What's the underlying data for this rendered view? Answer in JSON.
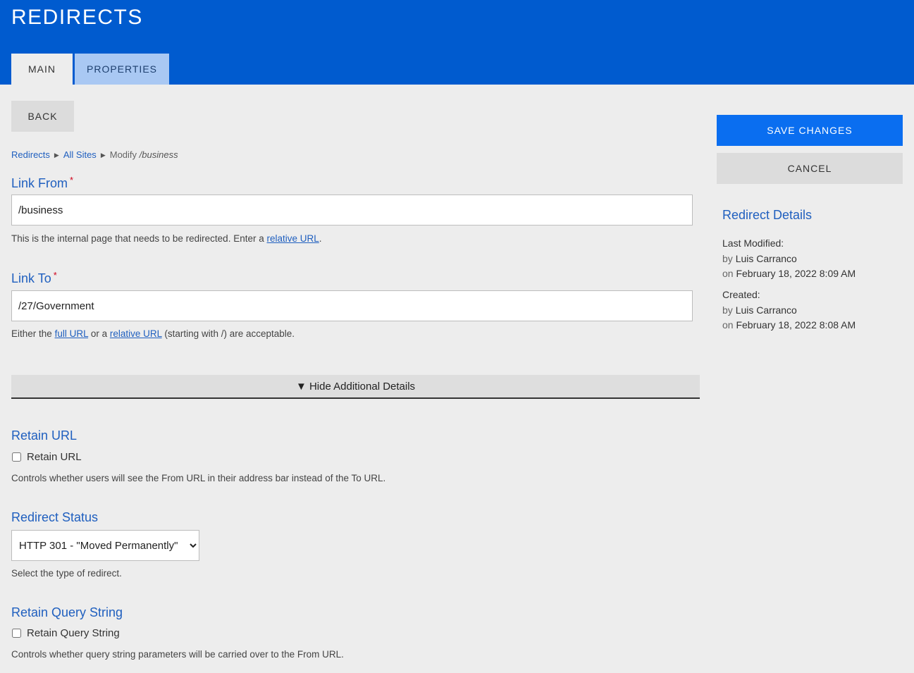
{
  "header": {
    "title": "REDIRECTS",
    "tabs": [
      {
        "label": "MAIN"
      },
      {
        "label": "PROPERTIES"
      }
    ]
  },
  "toolbar": {
    "back_label": "BACK",
    "save_label": "SAVE CHANGES",
    "cancel_label": "CANCEL"
  },
  "breadcrumb": {
    "items": [
      "Redirects",
      "All Sites"
    ],
    "current_prefix": "Modify",
    "current_path": "/business"
  },
  "form": {
    "link_from": {
      "label": "Link From",
      "value": "/business",
      "help_text": "This is the internal page that needs to be redirected. Enter a",
      "help_link": "relative URL",
      "help_end": "."
    },
    "link_to": {
      "label": "Link To",
      "value": "/27/Government",
      "help_start": "Either the",
      "help_link1": "full URL",
      "help_mid": "or a",
      "help_link2": "relative URL",
      "help_end": "(starting with /) are acceptable."
    },
    "toggle_label": "▼ Hide Additional Details",
    "retain_url": {
      "heading": "Retain URL",
      "checkbox_label": "Retain URL",
      "checked": false,
      "help": "Controls whether users will see the From URL in their address bar instead of the To URL."
    },
    "redirect_status": {
      "heading": "Redirect Status",
      "selected": "HTTP 301 - \"Moved Permanently\"",
      "help": "Select the type of redirect."
    },
    "retain_query": {
      "heading": "Retain Query String",
      "checkbox_label": "Retain Query String",
      "checked": false,
      "help": "Controls whether query string parameters will be carried over to the From URL."
    }
  },
  "details": {
    "title": "Redirect Details",
    "last_modified_label": "Last Modified:",
    "last_modified_by_prefix": "by",
    "last_modified_by": "Luis Carranco",
    "last_modified_on_prefix": "on",
    "last_modified_on": "February 18, 2022 8:09 AM",
    "created_label": "Created:",
    "created_by_prefix": "by",
    "created_by": "Luis Carranco",
    "created_on_prefix": "on",
    "created_on": "February 18, 2022 8:08 AM"
  },
  "colors": {
    "header_blue": "#005bcf",
    "primary_button": "#0a6ef0",
    "link_blue": "#1f5fbf",
    "required_red": "#d0021b"
  }
}
